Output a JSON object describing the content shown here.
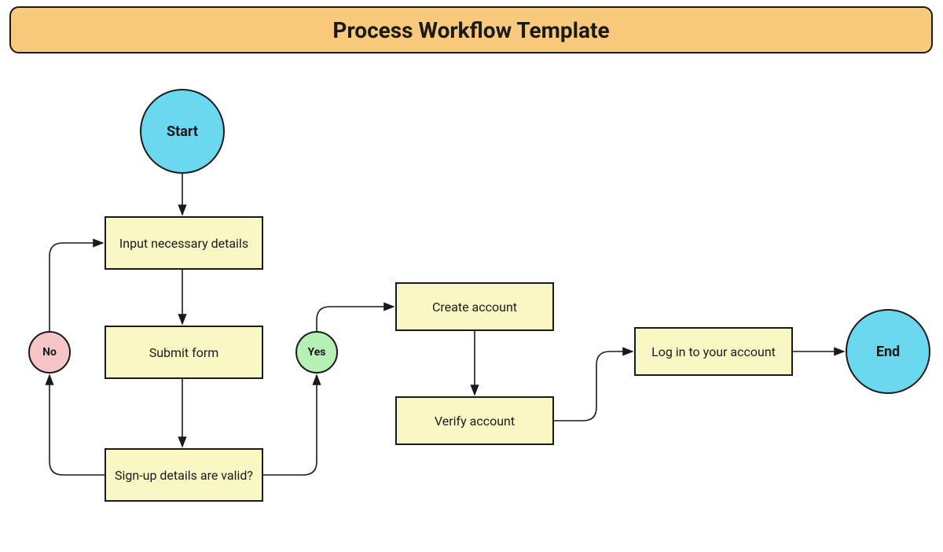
{
  "title": "Process Workflow Template",
  "nodes": {
    "start": {
      "label": "Start"
    },
    "input_details": {
      "label": "Input necessary details"
    },
    "submit_form": {
      "label": "Submit form"
    },
    "validate": {
      "label": "Sign-up details are valid?"
    },
    "no": {
      "label": "No"
    },
    "yes": {
      "label": "Yes"
    },
    "create_account": {
      "label": "Create account"
    },
    "verify_account": {
      "label": "Verify account"
    },
    "login": {
      "label": "Log in to your account"
    },
    "end": {
      "label": "End"
    }
  },
  "colors": {
    "banner_bg": "#f9c97c",
    "terminal_bg": "#6ad8ef",
    "process_bg": "#f9f8c5",
    "yes_bg": "#b5f0b5",
    "no_bg": "#f6c6c6",
    "stroke": "#1a1a1a"
  }
}
